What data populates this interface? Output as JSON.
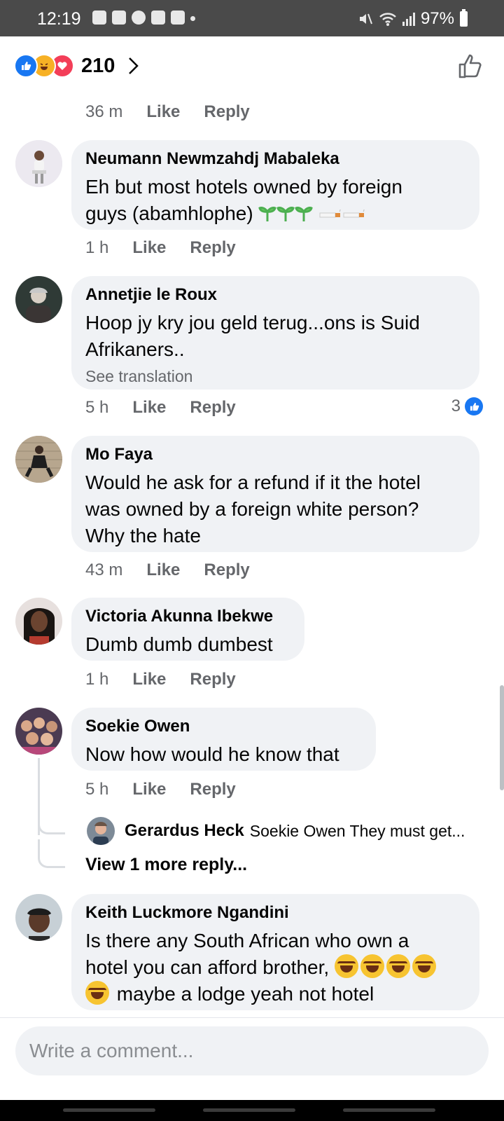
{
  "status_bar": {
    "time": "12:19",
    "battery": "97%"
  },
  "reactions": {
    "count": "210"
  },
  "comments": [
    {
      "ago": "36 m",
      "like": "Like",
      "reply": "Reply"
    },
    {
      "name": "Neumann Newmzahdj Mabaleka",
      "text_a": "Eh but most hotels owned by foreign",
      "text_b": "guys (abamhlophe)",
      "ago": "1 h",
      "like": "Like",
      "reply": "Reply"
    },
    {
      "name": "Annetjie le Roux",
      "text_a": "Hoop jy kry jou geld terug...ons is Suid",
      "text_b": "Afrikaners..",
      "see_translation": "See translation",
      "ago": "5 h",
      "like": "Like",
      "reply": "Reply",
      "likes": "3"
    },
    {
      "name": "Mo Faya",
      "text_a": "Would he ask for a refund if it the hotel",
      "text_b": "was owned by a foreign white person?",
      "text_c": "Why the hate",
      "ago": "43 m",
      "like": "Like",
      "reply": "Reply"
    },
    {
      "name": "Victoria Akunna Ibekwe",
      "text_a": "Dumb dumb dumbest",
      "ago": "1 h",
      "like": "Like",
      "reply": "Reply"
    },
    {
      "name": "Soekie Owen",
      "text_a": "Now how would he know that",
      "ago": "5 h",
      "like": "Like",
      "reply": "Reply"
    },
    {
      "name": "Keith Luckmore Ngandini",
      "text_a": "Is there any South African who own a",
      "text_b": "hotel you can afford brother,",
      "text_c": "maybe a lodge yeah not hotel"
    }
  ],
  "reply_preview": {
    "name": "Gerardus Heck",
    "text": "Soekie Owen They must get...",
    "view_more": "View 1 more reply..."
  },
  "composer": {
    "placeholder": "Write a comment..."
  },
  "colors": {
    "accent": "#1877f2",
    "bubble": "#f0f2f5",
    "meta": "#65676b"
  }
}
